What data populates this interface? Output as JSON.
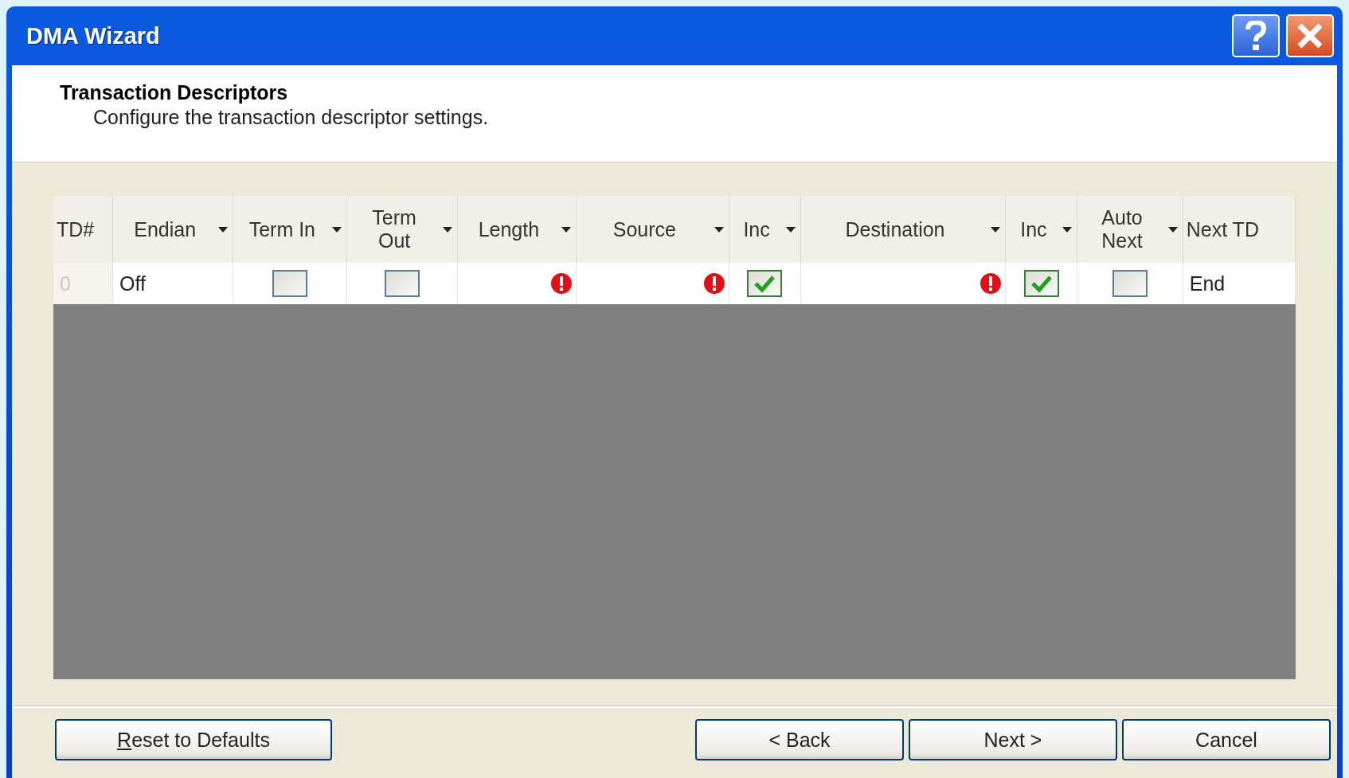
{
  "window": {
    "title": "DMA Wizard"
  },
  "header": {
    "title": "Transaction Descriptors",
    "subtitle": "Configure the transaction descriptor settings."
  },
  "grid": {
    "columns": [
      {
        "label": "TD#",
        "kind": "plain"
      },
      {
        "label": "Endian",
        "kind": "dropdown"
      },
      {
        "label": "Term In",
        "kind": "dropdown"
      },
      {
        "label": "Term Out",
        "kind": "dropdown"
      },
      {
        "label": "Length",
        "kind": "dropdown"
      },
      {
        "label": "Source",
        "kind": "dropdown"
      },
      {
        "label": "Inc",
        "kind": "dropdown"
      },
      {
        "label": "Destination",
        "kind": "dropdown"
      },
      {
        "label": "Inc",
        "kind": "dropdown"
      },
      {
        "label": "Auto Next",
        "kind": "dropdown"
      },
      {
        "label": "Next TD",
        "kind": "plain"
      }
    ],
    "rows": [
      {
        "cells": [
          {
            "kind": "index",
            "text": "0"
          },
          {
            "kind": "text",
            "text": "Off"
          },
          {
            "kind": "checkbox",
            "checked": false
          },
          {
            "kind": "checkbox",
            "checked": false
          },
          {
            "kind": "error"
          },
          {
            "kind": "error"
          },
          {
            "kind": "checkbox",
            "checked": true
          },
          {
            "kind": "error"
          },
          {
            "kind": "checkbox",
            "checked": true
          },
          {
            "kind": "checkbox",
            "checked": false
          },
          {
            "kind": "text",
            "text": "End"
          }
        ]
      }
    ]
  },
  "left_buttons": [
    {
      "label": "Reset to Defaults",
      "mnemonic": true
    }
  ],
  "right_buttons": [
    {
      "label": "< Back",
      "mnemonic": false
    },
    {
      "label": "Next >",
      "mnemonic": false
    },
    {
      "label": "Cancel",
      "mnemonic": false
    }
  ]
}
